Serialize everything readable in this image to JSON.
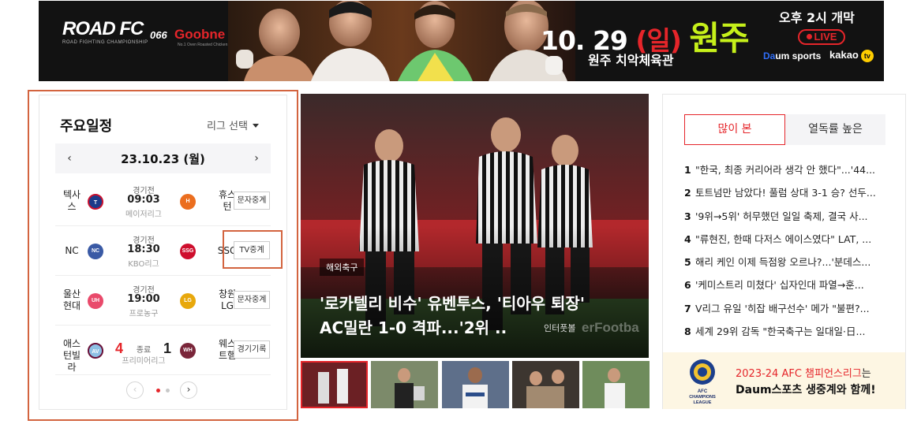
{
  "banner": {
    "logo": "ROAD FC",
    "logo_sub": "ROAD FIGHTING CHAMPIONSHIP",
    "event_no": "066",
    "sponsor": "Goobne",
    "sponsor_sub": "No.1 Oven Roasted Chicken",
    "date": "10. 29",
    "day": "(일)",
    "city": "원주",
    "venue": "원주 치악체육관",
    "time": "오후 2시 개막",
    "live": "LIVE",
    "broadcaster1_a": "Da",
    "broadcaster1_b": "um sports",
    "broadcaster2": "kakao",
    "broadcaster2_badge": "tv"
  },
  "schedule": {
    "title": "주요일정",
    "league_select": "리그 선택",
    "prev_arrow": "‹",
    "next_arrow": "›",
    "date": "23.10.23 (월)",
    "games": [
      {
        "home": "텍사스",
        "away": "휴스턴",
        "status": "경기전",
        "time": "09:03",
        "league": "메이저리그",
        "button": "문자중계",
        "home_logo": "T",
        "away_logo": "H",
        "home_color": "#1b3b8a",
        "away_color": "#eb6e1f"
      },
      {
        "home": "NC",
        "away": "SSG",
        "status": "경기전",
        "time": "18:30",
        "league": "KBO리그",
        "button": "TV중계",
        "home_logo": "NC",
        "away_logo": "SSG",
        "home_color": "#3a5aa5",
        "away_color": "#ce0e2d"
      },
      {
        "home": "울산현대",
        "away": "창원LG",
        "status": "경기전",
        "time": "19:00",
        "league": "프로농구",
        "button": "문자중계",
        "home_logo": "UH",
        "away_logo": "LG",
        "home_color": "#e94a6b",
        "away_color": "#e8a80c"
      },
      {
        "home": "애스턴빌라",
        "away": "웨스트햄",
        "status": "종료",
        "home_score": "4",
        "away_score": "1",
        "league": "프리미어리그",
        "button": "경기기록",
        "home_logo": "AV",
        "away_logo": "WH",
        "home_color": "#8ec0e4",
        "away_color": "#7a263a"
      }
    ],
    "pager_prev": "‹",
    "pager_next": "›"
  },
  "news": {
    "badge": "해외축구",
    "title": "'로카텔리 비수' 유벤투스, '티아우 퇴장' AC밀란 1-0 격파...'2위 ..",
    "credit": "인터풋볼",
    "watermark": "erFootba"
  },
  "ranking": {
    "tab_active": "많이 본",
    "tab_inactive": "열독률 높은",
    "items": [
      {
        "rank": "1",
        "text": "\"한국, 최종 커리어라 생각 안 했다\"...'44..."
      },
      {
        "rank": "2",
        "text": "토트넘만 남았다! 풀럼 상대 3-1 승? 선두..."
      },
      {
        "rank": "3",
        "text": "'9위→5위' 허무했던 일일 축제, 결국 사..."
      },
      {
        "rank": "4",
        "text": "\"류현진, 한때 다저스 에이스였다\" LAT, ..."
      },
      {
        "rank": "5",
        "text": "해리 케인 이제 득점왕 오르나?...'분데스..."
      },
      {
        "rank": "6",
        "text": "'케미스트리 미쳤다' 십자인대 파열→훈..."
      },
      {
        "rank": "7",
        "text": "V리그 유일 '히잡 배구선수' 메가 \"불편?..."
      },
      {
        "rank": "8",
        "text": "세계 29위 감독 \"한국축구는 일대일·日..."
      }
    ],
    "promo_line1_hl": "2023-24 AFC 챔피언스리그",
    "promo_line1_rest": "는",
    "promo_line2": "Daum스포츠 생중계와 함께!",
    "promo_logo_text": "AFC CHAMPIONS LEAGUE"
  },
  "colors": {
    "accent": "#e5252a",
    "highlight": "#d3643f"
  }
}
